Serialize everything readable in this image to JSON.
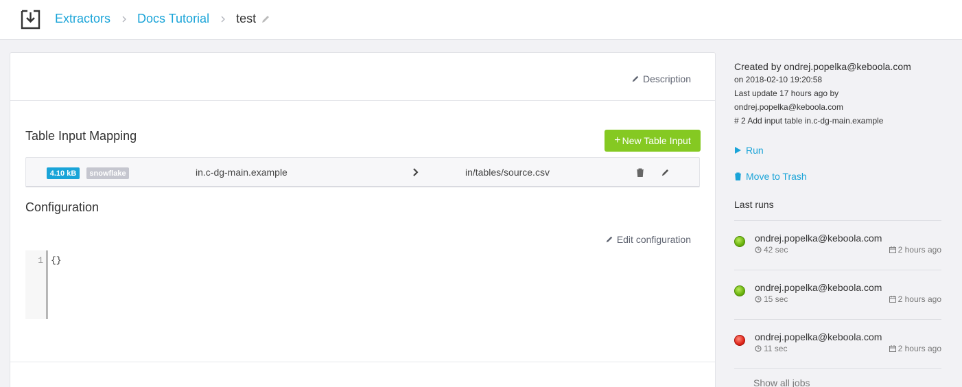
{
  "breadcrumb": {
    "items": [
      "Extractors",
      "Docs Tutorial"
    ],
    "current": "test"
  },
  "main": {
    "description_label": "Description",
    "input_mapping": {
      "title": "Table Input Mapping",
      "new_button_label": "New Table Input",
      "rows": [
        {
          "size_badge": "4.10 kB",
          "backend_badge": "snowflake",
          "source": "in.c-dg-main.example",
          "destination": "in/tables/source.csv"
        }
      ]
    },
    "configuration": {
      "title": "Configuration",
      "edit_label": "Edit configuration",
      "line_numbers": [
        "1"
      ],
      "code": "{}"
    }
  },
  "sidebar": {
    "created_by": "Created by ondrej.popelka@keboola.com",
    "created_on": "on 2018-02-10 19:20:58",
    "last_update": "Last update 17 hours ago by",
    "last_update_user": "ondrej.popelka@keboola.com",
    "version_note": "# 2 Add input table in.c-dg-main.example",
    "run_label": "Run",
    "trash_label": "Move to Trash",
    "last_runs_title": "Last runs",
    "runs": [
      {
        "user": "ondrej.popelka@keboola.com",
        "duration": "42 sec",
        "time": "2 hours ago",
        "status": "success"
      },
      {
        "user": "ondrej.popelka@keboola.com",
        "duration": "15 sec",
        "time": "2 hours ago",
        "status": "success"
      },
      {
        "user": "ondrej.popelka@keboola.com",
        "duration": "11 sec",
        "time": "2 hours ago",
        "status": "error"
      }
    ],
    "show_all_label": "Show all jobs"
  },
  "colors": {
    "accent": "#1aa4d8",
    "success_button": "#85c922",
    "status_success": "#6bb30e",
    "status_error": "#e0271c"
  }
}
